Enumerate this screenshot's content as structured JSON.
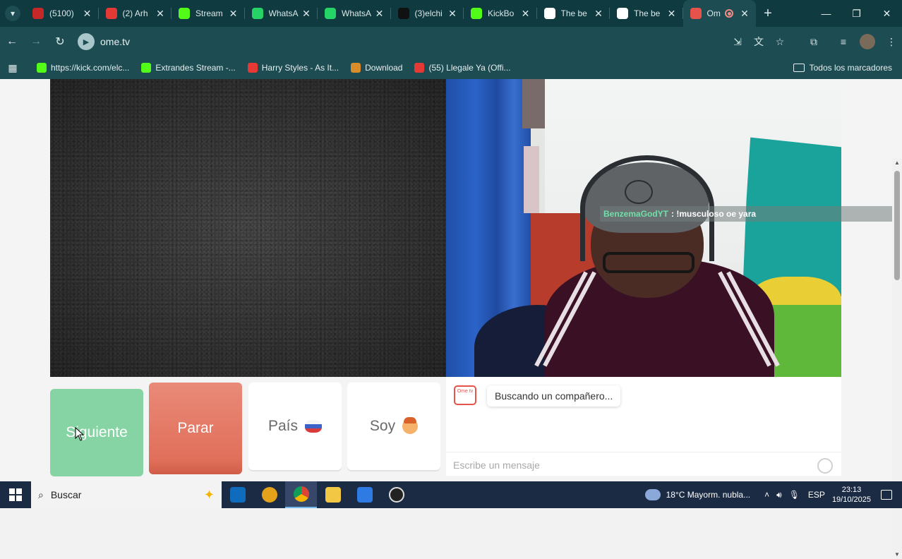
{
  "browser": {
    "tabs": [
      {
        "title": "(5100)",
        "favicon": "live-stream-icon",
        "color": "#c62828"
      },
      {
        "title": "(2) Arh",
        "favicon": "youtube-icon",
        "color": "#e53935"
      },
      {
        "title": "Stream",
        "favicon": "kick-icon",
        "color": "#53fc18"
      },
      {
        "title": "WhatsA",
        "favicon": "whatsapp-icon",
        "color": "#25d366"
      },
      {
        "title": "WhatsA",
        "favicon": "whatsapp-icon",
        "color": "#25d366"
      },
      {
        "title": "(3)elchi",
        "favicon": "tiktok-icon",
        "color": "#111111"
      },
      {
        "title": "KickBo",
        "favicon": "kickbot-icon",
        "color": "#53fc18"
      },
      {
        "title": "The be",
        "favicon": "diamond-icon",
        "color": "#ffffff"
      },
      {
        "title": "The be",
        "favicon": "diamond-icon",
        "color": "#ffffff"
      },
      {
        "title": "Om",
        "favicon": "ometv-icon",
        "color": "#e5534b"
      }
    ],
    "url": "ome.tv",
    "bookmarks": [
      {
        "label": "https://kick.com/elc...",
        "favicon": "kick-icon",
        "color": "#53fc18"
      },
      {
        "label": "Extrandes Stream -...",
        "favicon": "kick-icon",
        "color": "#53fc18"
      },
      {
        "label": "Harry Styles - As It...",
        "favicon": "youtube-icon",
        "color": "#e53935"
      },
      {
        "label": "Download",
        "favicon": "r-icon",
        "color": "#d98c2b"
      },
      {
        "label": "(55) Llegale Ya (Offi...",
        "favicon": "youtube-icon",
        "color": "#e53935"
      }
    ],
    "all_bookmarks": "Todos los marcadores"
  },
  "video": {
    "overlay_user": "BenzemaGodYT",
    "overlay_text": ": !musculoso oe yara"
  },
  "controls": {
    "next": "Siguiente",
    "stop": "Parar",
    "country": "País",
    "gender": "Soy"
  },
  "chat": {
    "logo_text": "Ome tv",
    "status": "Buscando un compañero...",
    "placeholder": "Escribe un mensaje"
  },
  "taskbar": {
    "search": "Buscar",
    "weather": "18°C  Mayorm. nubla...",
    "language": "ESP",
    "time": "23:13",
    "date": "19/10/2025"
  }
}
